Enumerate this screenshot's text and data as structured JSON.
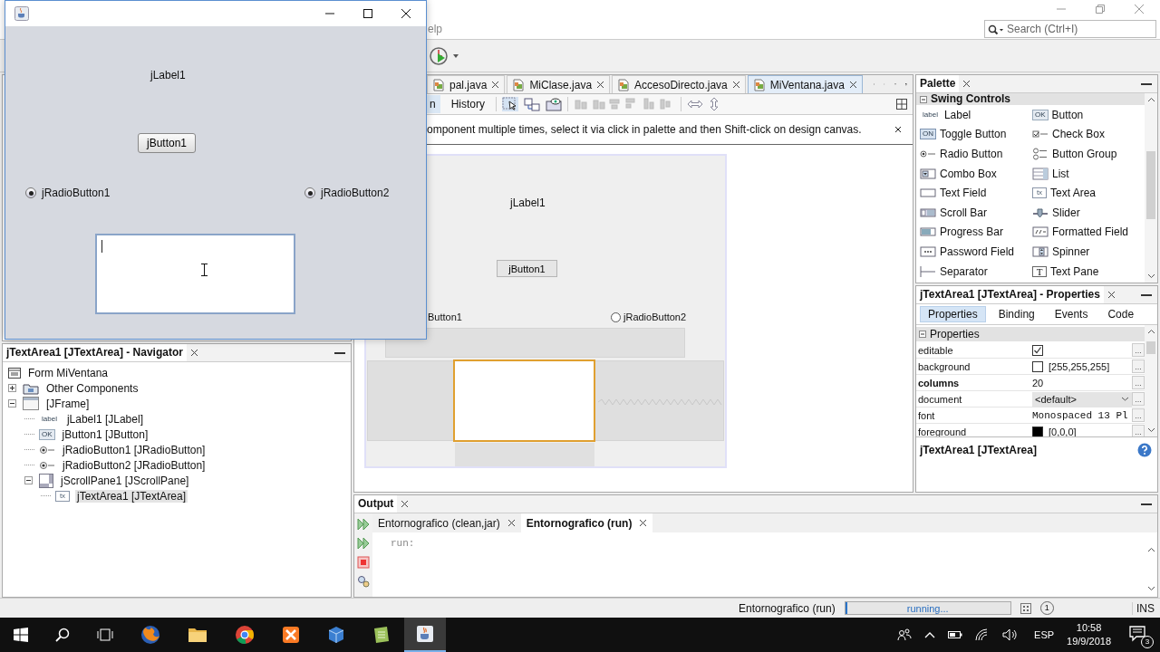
{
  "ide": {
    "menu_fragment": "elp",
    "search": {
      "placeholder": "Search (Ctrl+I)"
    }
  },
  "editor": {
    "tabs": [
      {
        "label": "pal.java",
        "selected": false
      },
      {
        "label": "MiClase.java",
        "selected": false
      },
      {
        "label": "AccesoDirecto.java",
        "selected": false
      },
      {
        "label": "MiVentana.java",
        "selected": true
      }
    ],
    "view_tabs": [
      {
        "label": "n",
        "selected": true
      },
      {
        "label": "History",
        "selected": false
      }
    ],
    "hint": "omponent multiple times, select it via click in palette and then Shift-click on design canvas.",
    "form": {
      "label": "jLabel1",
      "button": "jButton1",
      "radios": [
        {
          "label": "Button1"
        },
        {
          "label": "jRadioButton2",
          "selected": false
        }
      ]
    }
  },
  "navigator": {
    "title": "jTextArea1 [JTextArea] - Navigator",
    "tree": [
      {
        "label": "Form MiVentana",
        "kind": "form",
        "selected": false
      },
      {
        "label": "Other Components",
        "kind": "folder",
        "expanded": false,
        "selected": false
      },
      {
        "label": "[JFrame]",
        "kind": "frame",
        "expanded": true,
        "selected": false,
        "children": [
          {
            "label": "jLabel1 [JLabel]",
            "kind": "label",
            "badge": "label",
            "selected": false
          },
          {
            "label": "jButton1 [JButton]",
            "kind": "button",
            "badge": "OK",
            "selected": false
          },
          {
            "label": "jRadioButton1 [JRadioButton]",
            "kind": "radio",
            "selected": false
          },
          {
            "label": "jRadioButton2 [JRadioButton]",
            "kind": "radio",
            "selected": false
          },
          {
            "label": "jScrollPane1 [JScrollPane]",
            "kind": "scroll",
            "expanded": true,
            "selected": false,
            "children": [
              {
                "label": "jTextArea1 [JTextArea]",
                "kind": "textarea",
                "badge": "tx",
                "selected": true
              }
            ]
          }
        ]
      }
    ]
  },
  "palette": {
    "title": "Palette",
    "section": "Swing Controls",
    "items": [
      {
        "label": "Label",
        "kind": "label",
        "badge": "label"
      },
      {
        "label": "Button",
        "kind": "button",
        "badge": "OK"
      },
      {
        "label": "Toggle Button",
        "kind": "toggle",
        "badge": "ON"
      },
      {
        "label": "Check Box",
        "kind": "checkbox"
      },
      {
        "label": "Radio Button",
        "kind": "radio"
      },
      {
        "label": "Button Group",
        "kind": "group"
      },
      {
        "label": "Combo Box",
        "kind": "combo"
      },
      {
        "label": "List",
        "kind": "list"
      },
      {
        "label": "Text Field",
        "kind": "field"
      },
      {
        "label": "Text Area",
        "kind": "textarea",
        "badge": "tx"
      },
      {
        "label": "Scroll Bar",
        "kind": "scrollbar"
      },
      {
        "label": "Slider",
        "kind": "slider"
      },
      {
        "label": "Progress Bar",
        "kind": "progress"
      },
      {
        "label": "Formatted Field",
        "kind": "formatted"
      },
      {
        "label": "Password Field",
        "kind": "password"
      },
      {
        "label": "Spinner",
        "kind": "spinner"
      },
      {
        "label": "Separator",
        "kind": "separator"
      },
      {
        "label": "Text Pane",
        "kind": "textpane",
        "badge": "T"
      }
    ]
  },
  "properties": {
    "title": "jTextArea1 [JTextArea] - Properties",
    "tabs": [
      {
        "label": "Properties",
        "selected": true
      },
      {
        "label": "Binding",
        "selected": false
      },
      {
        "label": "Events",
        "selected": false
      },
      {
        "label": "Code",
        "selected": false
      }
    ],
    "section": "Properties",
    "rows": [
      {
        "name": "editable",
        "kind": "check",
        "checked": true,
        "modified": false,
        "action": "..."
      },
      {
        "name": "background",
        "kind": "color",
        "color": "#ffffff",
        "value": "[255,255,255]",
        "modified": false,
        "action": "..."
      },
      {
        "name": "columns",
        "kind": "text",
        "value": "20",
        "modified": true,
        "action": "..."
      },
      {
        "name": "document",
        "kind": "combo",
        "value": "<default>",
        "modified": false,
        "action": "..."
      },
      {
        "name": "font",
        "kind": "mono",
        "value": "Monospaced 13 Pl",
        "modified": false,
        "action": "..."
      },
      {
        "name": "foreground",
        "kind": "color",
        "color": "#000000",
        "value": "[0,0,0]",
        "modified": false,
        "action": "..."
      }
    ],
    "footer": "jTextArea1 [JTextArea]"
  },
  "output": {
    "title": "Output",
    "tabs": [
      {
        "label": "Entornografico (clean,jar)",
        "selected": false
      },
      {
        "label": "Entornografico (run)",
        "selected": true
      }
    ],
    "text": "run:"
  },
  "status_bar": {
    "task": "Entornografico (run)",
    "progress": "running...",
    "level": 0.01,
    "notifications": "1",
    "mode": "INS"
  },
  "taskbar": {
    "language": "ESP",
    "time": "10:58",
    "date": "19/9/2018",
    "notifications": "3"
  },
  "running_window": {
    "label": "jLabel1",
    "button": "jButton1",
    "radios": [
      {
        "label": "jRadioButton1",
        "selected": true
      },
      {
        "label": "jRadioButton2",
        "selected": true
      }
    ]
  }
}
